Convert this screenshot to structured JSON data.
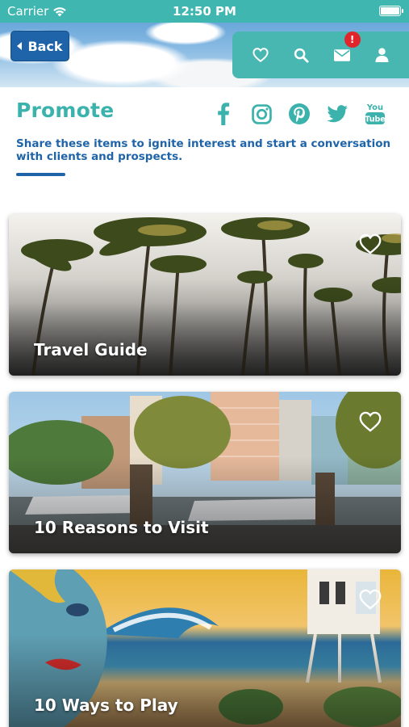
{
  "status_bar": {
    "carrier": "Carrier",
    "time": "12:50 PM",
    "battery_level": 1.0
  },
  "header": {
    "back_label": "Back",
    "actions": [
      {
        "icon": "heart-icon"
      },
      {
        "icon": "search-icon"
      },
      {
        "icon": "mail-icon",
        "badge": "!"
      },
      {
        "icon": "user-icon"
      }
    ]
  },
  "promote": {
    "title": "Promote",
    "description": "Share these items to ignite interest and start a conversation with clients and prospects.",
    "socials": [
      "facebook-icon",
      "instagram-icon",
      "pinterest-icon",
      "twitter-icon",
      "youtube-icon"
    ],
    "youtube_line1": "You",
    "youtube_line2": "Tube"
  },
  "cards": [
    {
      "title": "Travel Guide"
    },
    {
      "title": "10 Reasons to Visit"
    },
    {
      "title": "10 Ways to Play"
    }
  ],
  "colors": {
    "teal": "#3fb7b0",
    "blue": "#1f64a8",
    "badge_red": "#e0262b"
  }
}
